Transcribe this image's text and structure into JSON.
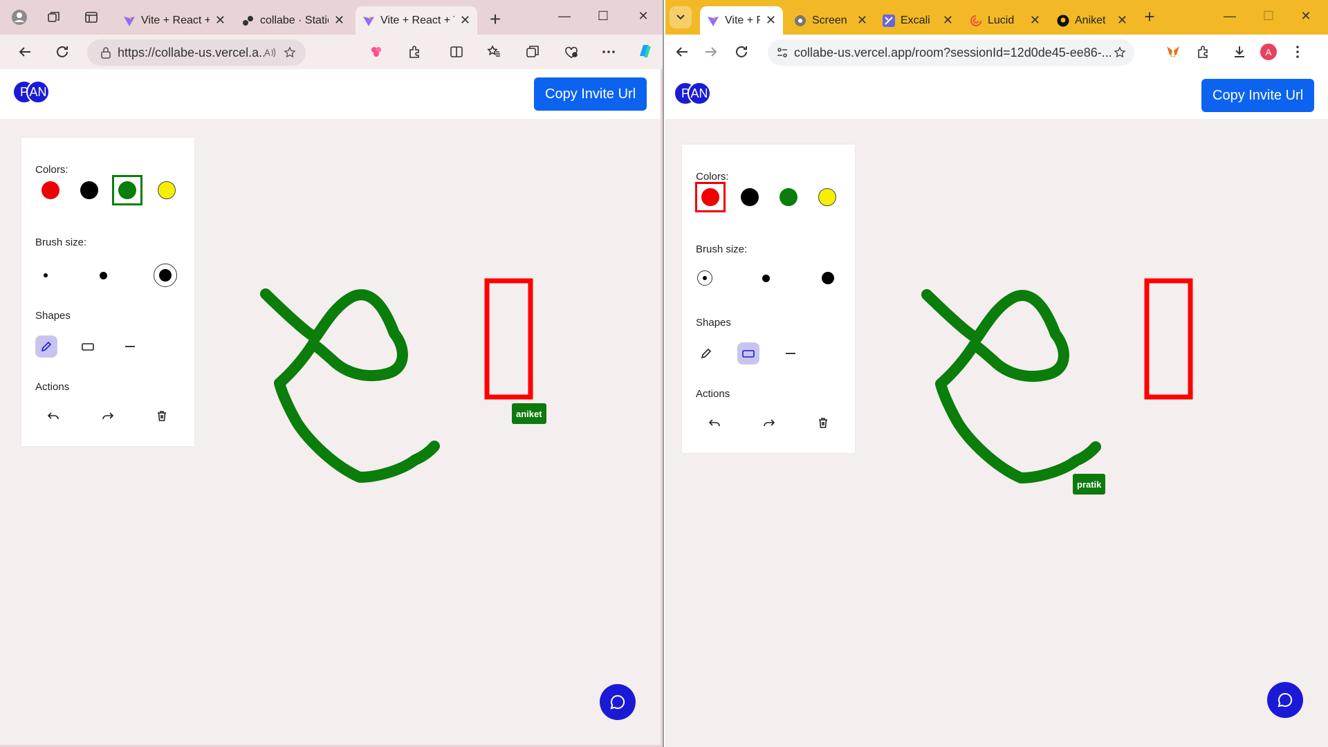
{
  "left_browser": {
    "tabs": [
      {
        "label": "Vite + React + TS"
      },
      {
        "label": "collabe · Static"
      },
      {
        "label": "Vite + React + TS"
      }
    ],
    "url": "https://collabe-us.vercel.a...",
    "window_controls": {
      "minimize": "—",
      "maximize": "☐",
      "close": "✕"
    },
    "new_tab": "+"
  },
  "right_browser": {
    "tabs": [
      {
        "label": "Vite + React"
      },
      {
        "label": "Screen"
      },
      {
        "label": "Excali"
      },
      {
        "label": "Lucid"
      },
      {
        "label": "Aniket"
      }
    ],
    "url": "collabe-us.vercel.app/room?sessionId=12d0de45-ee86-...",
    "profile_initial": "A",
    "window_controls": {
      "minimize": "—",
      "maximize": "☐",
      "close": "✕"
    },
    "new_tab": "+"
  },
  "app": {
    "invite_label": "Copy Invite Url",
    "avatars": [
      "P",
      "AN"
    ],
    "colors_label": "Colors:",
    "brush_label": "Brush size:",
    "shapes_label": "Shapes",
    "actions_label": "Actions",
    "palette": [
      "#f00000",
      "#000000",
      "#0a7d0a",
      "#f5f000"
    ],
    "accent": "#0b63f0",
    "stroke_color": "#0a7d0a",
    "rect_color": "#ff0000"
  },
  "left_app": {
    "selected_color": "green",
    "selected_brush": "large",
    "selected_tool": "pencil",
    "cursor_name": "aniket"
  },
  "right_app": {
    "selected_color": "red",
    "selected_brush": "small",
    "selected_tool": "rectangle",
    "cursor_name": "pratik"
  }
}
